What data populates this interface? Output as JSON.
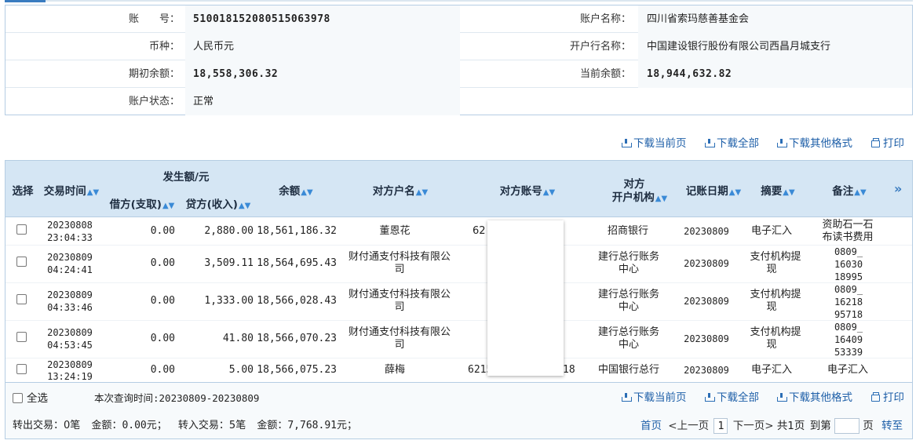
{
  "account": {
    "number_label": "账　　号：",
    "number": "510018152080515063978",
    "name_label": "账户名称：",
    "name": "四川省索玛慈善基金会",
    "currency_label": "币种：",
    "currency": "人民币元",
    "bank_label": "开户行名称：",
    "bank": "中国建设银行股份有限公司西昌月城支行",
    "opening_label": "期初余额：",
    "opening": "18,558,306.32",
    "current_label": "当前余额：",
    "current": "18,944,632.82",
    "status_label": "账户状态：",
    "status": "正常"
  },
  "toolbar": {
    "download_page": "下载当前页",
    "download_all": "下载全部",
    "download_other": "下载其他格式",
    "print": "打印"
  },
  "columns": {
    "select": "选择",
    "time": "交易时间",
    "amount_group": "发生额/元",
    "debit": "借方(支取)",
    "credit": "贷方(收入)",
    "balance": "余额",
    "party_name": "对方户名",
    "party_account": "对方账号",
    "party_bank_1": "对方",
    "party_bank_2": "开户机构",
    "post_date": "记账日期",
    "summary": "摘要",
    "remark": "备注",
    "more": "»"
  },
  "rows": [
    {
      "date": "20230808",
      "time": "23:04:33",
      "debit": "0.00",
      "credit": "2,880.00",
      "balance": "18,561,186.32",
      "name_1": "董恩花",
      "name_2": "",
      "acct": "62",
      "bank_1": "招商银行",
      "bank_2": "",
      "post": "20230809",
      "sum_1": "电子汇入",
      "sum_2": "",
      "rmk_1": "资助石一石",
      "rmk_2": "布读书费用",
      "rmk_3": ""
    },
    {
      "date": "20230809",
      "time": "04:24:41",
      "debit": "0.00",
      "credit": "3,509.11",
      "balance": "18,564,695.43",
      "name_1": "财付通支付科技有限公",
      "name_2": "司",
      "acct": "",
      "bank_1": "建行总行账务",
      "bank_2": "中心",
      "post": "20230809",
      "sum_1": "支付机构提",
      "sum_2": "现",
      "rmk_1": "0809_",
      "rmk_2": "16030",
      "rmk_3": "18995"
    },
    {
      "date": "20230809",
      "time": "04:33:46",
      "debit": "0.00",
      "credit": "1,333.00",
      "balance": "18,566,028.43",
      "name_1": "财付通支付科技有限公",
      "name_2": "司",
      "acct": "",
      "bank_1": "建行总行账务",
      "bank_2": "中心",
      "post": "20230809",
      "sum_1": "支付机构提",
      "sum_2": "现",
      "rmk_1": "0809_",
      "rmk_2": "16218",
      "rmk_3": "95718"
    },
    {
      "date": "20230809",
      "time": "04:53:45",
      "debit": "0.00",
      "credit": "41.80",
      "balance": "18,566,070.23",
      "name_1": "财付通支付科技有限公",
      "name_2": "司",
      "acct": "",
      "bank_1": "建行总行账务",
      "bank_2": "中心",
      "post": "20230809",
      "sum_1": "支付机构提",
      "sum_2": "现",
      "rmk_1": "0809_",
      "rmk_2": "16409",
      "rmk_3": "53339"
    },
    {
      "date": "20230809",
      "time": "13:24:19",
      "debit": "0.00",
      "credit": "5.00",
      "balance": "18,566,075.23",
      "name_1": "薛梅",
      "name_2": "",
      "acct": "6215",
      "acct_tail": "18",
      "bank_1": "中国银行总行",
      "bank_2": "",
      "post": "20230809",
      "sum_1": "电子汇入",
      "sum_2": "",
      "rmk_1": "电子汇入",
      "rmk_2": "",
      "rmk_3": ""
    }
  ],
  "footer": {
    "select_all": "全选",
    "query_range": "本次查询时间:20230809-20230809",
    "out_label": "转出交易：",
    "out_count": "0笔",
    "out_amount_label": "金额：",
    "out_amount": "0.00元；",
    "in_label": "转入交易：",
    "in_count": "5笔",
    "in_amount_label": "金额：",
    "in_amount": "7,768.91元；"
  },
  "pager": {
    "first": "首页",
    "prev": "<上一页",
    "current": "1",
    "next": "下一页>",
    "total": "共1页",
    "goto_label": "到第",
    "page_unit": "页",
    "go": "转至"
  }
}
